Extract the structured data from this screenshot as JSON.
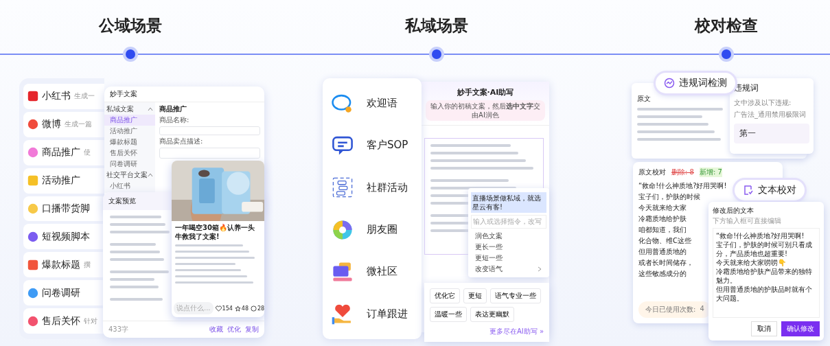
{
  "sections": [
    {
      "title": "公域场景"
    },
    {
      "title": "私域场景"
    },
    {
      "title": "校对检查"
    }
  ],
  "public": {
    "items": [
      {
        "name": "小红书",
        "desc": "生成一"
      },
      {
        "name": "微博",
        "desc": "生成一篇"
      },
      {
        "name": "商品推广",
        "desc": "使"
      },
      {
        "name": "活动推广"
      },
      {
        "name": "口播带货脚"
      },
      {
        "name": "短视频脚本"
      },
      {
        "name": "爆款标题",
        "desc": "撰"
      },
      {
        "name": "问卷调研"
      },
      {
        "name": "售后关怀",
        "desc": "针对"
      }
    ],
    "window": {
      "title": "妙手文案",
      "groups": [
        {
          "label": "私域文案",
          "expanded": true,
          "items": [
            {
              "label": "商品推广",
              "selected": true
            },
            {
              "label": "活动推广",
              "selected": false
            },
            {
              "label": "爆款标题",
              "selected": false
            },
            {
              "label": "售后关怀",
              "selected": false
            },
            {
              "label": "问卷调研",
              "selected": false
            }
          ]
        },
        {
          "label": "社交平台文案",
          "expanded": true,
          "items": [
            {
              "label": "小红书",
              "selected": false
            }
          ]
        }
      ],
      "form_title": "商品推广",
      "fields": [
        {
          "label": "商品名称:"
        },
        {
          "label": "商品卖点描述:"
        }
      ]
    },
    "preview": {
      "title": "文案预览",
      "word_count": "433字",
      "actions": [
        "收藏",
        "优化",
        "复制"
      ]
    },
    "post": {
      "title": "一年喝空30箱🔥认养一头牛救我了文案!",
      "comment_placeholder": "说点什么...",
      "likes": "154",
      "favorites": "48",
      "comments": "28"
    }
  },
  "private": {
    "channels": [
      "欢迎语",
      "客户SOP",
      "社群活动",
      "朋友圈",
      "微社区",
      "订单跟进"
    ],
    "assistant": {
      "title": "妙手文案·AI助写",
      "hint": "输入你的初稿文案，然后**选中文字**交由AI润色",
      "selected_text": "直播场景做私域，就选星云有客!",
      "command_placeholder": "输入或选择指令，改写",
      "commands": [
        {
          "label": "润色文案",
          "has_submenu": false
        },
        {
          "label": "更长一些",
          "has_submenu": false
        },
        {
          "label": "更短一些",
          "has_submenu": false
        },
        {
          "label": "改变语气",
          "has_submenu": true
        }
      ],
      "chips": [
        "优化它",
        "更短",
        "语气专业一些",
        "温暖一些",
        "表达更幽默"
      ],
      "more_link": "更多尽在AI助写 »"
    }
  },
  "check": {
    "violation": {
      "badge": "违规词检测",
      "original_label": "原文",
      "title": "违规词",
      "summary": "文中涉及以下违规:",
      "category": "广告法_通用禁用极限词",
      "word": "第一"
    },
    "proofread": {
      "badge": "文本校对",
      "title": "原文校对",
      "deleted": "删除: 8",
      "added": "新增: 7",
      "lines": [
        "“救命!什么神质地?好用哭啊!",
        "宝子们，护肤的时候",
        "今天就来给大家",
        "冷霜质地给护肤",
        "咱都知道，我们",
        "化合物、维C这些",
        "但用普通质地的",
        "或者长时间储存，",
        "这些敏感成分的"
      ],
      "usage_label": "今日已使用次数:",
      "usage_value": "4"
    },
    "modal": {
      "title": "修改后的文本",
      "hint": "下方输入框可直接编辑",
      "lines": [
        "“救命!什么神质地?好用哭啊!",
        "宝子们，护肤的时候可别只看成分，产品质地也超重要!",
        "今天就来给大家唠唠👇",
        "冷霜质地给护肤产品带来的独特魅力。",
        "但用普通质地的护肤品时就有个大问题。"
      ],
      "cancel": "取消",
      "confirm": "确认修改"
    }
  }
}
